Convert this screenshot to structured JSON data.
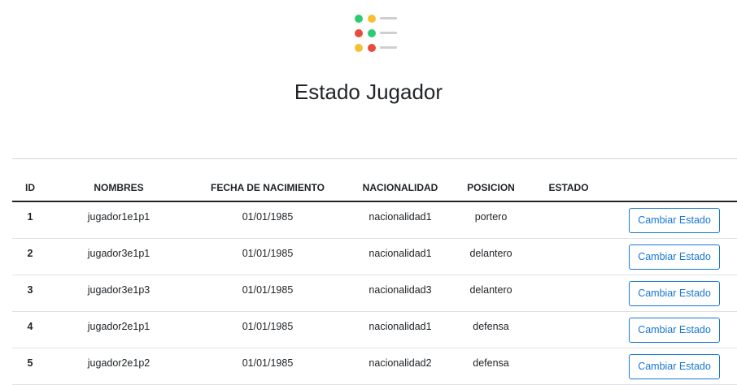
{
  "logo": {
    "icon": "list-logo-icon",
    "dot_colors": [
      "#2ecc71",
      "#f5c032",
      "#e74c3c",
      "#2ecc71",
      "#f5c032",
      "#e74c3c"
    ],
    "bar_color": "#cfcfcf"
  },
  "page": {
    "title": "Estado Jugador"
  },
  "table": {
    "columns": [
      "ID",
      "NOMBRES",
      "FECHA DE NACIMIENTO",
      "NACIONALIDAD",
      "POSICION",
      "ESTADO",
      ""
    ],
    "rows": [
      {
        "id": "1",
        "nombres": "jugador1e1p1",
        "fecha": "01/01/1985",
        "nacionalidad": "nacionalidad1",
        "posicion": "portero",
        "estado": "",
        "action": "Cambiar Estado"
      },
      {
        "id": "2",
        "nombres": "jugador3e1p1",
        "fecha": "01/01/1985",
        "nacionalidad": "nacionalidad1",
        "posicion": "delantero",
        "estado": "",
        "action": "Cambiar Estado"
      },
      {
        "id": "3",
        "nombres": "jugador3e1p3",
        "fecha": "01/01/1985",
        "nacionalidad": "nacionalidad3",
        "posicion": "delantero",
        "estado": "",
        "action": "Cambiar Estado"
      },
      {
        "id": "4",
        "nombres": "jugador2e1p1",
        "fecha": "01/01/1985",
        "nacionalidad": "nacionalidad1",
        "posicion": "defensa",
        "estado": "",
        "action": "Cambiar Estado"
      },
      {
        "id": "5",
        "nombres": "jugador2e1p2",
        "fecha": "01/01/1985",
        "nacionalidad": "nacionalidad2",
        "posicion": "defensa",
        "estado": "",
        "action": "Cambiar Estado"
      }
    ]
  },
  "colors": {
    "accent": "#1976d2",
    "text": "#212529",
    "row_border": "#dee2e6"
  }
}
